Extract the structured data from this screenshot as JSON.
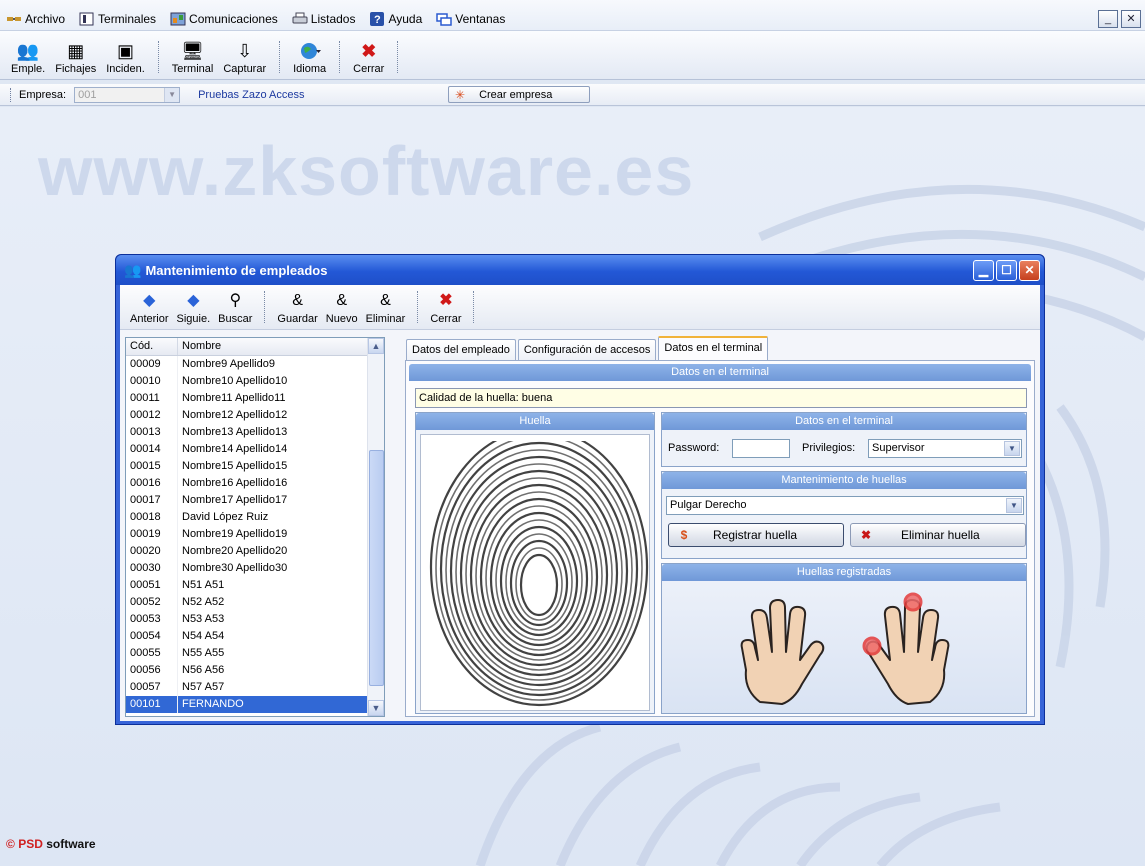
{
  "menu": {
    "items": [
      {
        "label": "Archivo",
        "icon": "plug-icon"
      },
      {
        "label": "Terminales",
        "icon": "terminal-icon"
      },
      {
        "label": "Comunicaciones",
        "icon": "network-icon"
      },
      {
        "label": "Listados",
        "icon": "printer-icon"
      },
      {
        "label": "Ayuda",
        "icon": "help-icon"
      },
      {
        "label": "Ventanas",
        "icon": "windows-icon"
      }
    ]
  },
  "toolbar": {
    "buttons": [
      {
        "label": "Emple.",
        "icon": "employees-icon"
      },
      {
        "label": "Fichajes",
        "icon": "clock-ins-icon"
      },
      {
        "label": "Inciden.",
        "icon": "incidents-icon"
      },
      {
        "label": "Terminal",
        "icon": "terminal-icon"
      },
      {
        "label": "Capturar",
        "icon": "capture-icon"
      },
      {
        "label": "Idioma",
        "icon": "globe-icon"
      },
      {
        "label": "Cerrar",
        "icon": "close-icon"
      }
    ]
  },
  "company": {
    "label": "Empresa:",
    "selected": "001",
    "name": "Pruebas Zazo  Access",
    "create_button": "Crear empresa"
  },
  "desktop": {
    "watermark": "www.zksoftware.es",
    "footer_copy": "©",
    "footer_brand": "PSD",
    "footer_suffix": "software"
  },
  "modal": {
    "title": "Mantenimiento de empleados",
    "toolbar": [
      {
        "label": "Anterior",
        "icon": "arrow-left-icon"
      },
      {
        "label": "Siguie.",
        "icon": "arrow-right-icon"
      },
      {
        "label": "Buscar",
        "icon": "search-icon"
      },
      {
        "label": "Guardar",
        "icon": "save-icon"
      },
      {
        "label": "Nuevo",
        "icon": "add-user-icon"
      },
      {
        "label": "Eliminar",
        "icon": "remove-user-icon"
      },
      {
        "label": "Cerrar",
        "icon": "close-icon"
      }
    ],
    "list": {
      "headers": [
        "Cód.",
        "Nombre"
      ],
      "rows": [
        [
          "00009",
          "Nombre9 Apellido9"
        ],
        [
          "00010",
          "Nombre10 Apellido10"
        ],
        [
          "00011",
          "Nombre11 Apellido11"
        ],
        [
          "00012",
          "Nombre12 Apellido12"
        ],
        [
          "00013",
          "Nombre13 Apellido13"
        ],
        [
          "00014",
          "Nombre14 Apellido14"
        ],
        [
          "00015",
          "Nombre15 Apellido15"
        ],
        [
          "00016",
          "Nombre16 Apellido16"
        ],
        [
          "00017",
          "Nombre17 Apellido17"
        ],
        [
          "00018",
          "David López Ruiz"
        ],
        [
          "00019",
          "Nombre19 Apellido19"
        ],
        [
          "00020",
          "Nombre20 Apellido20"
        ],
        [
          "00030",
          "Nombre30 Apellido30"
        ],
        [
          "00051",
          "N51 A51"
        ],
        [
          "00052",
          "N52 A52"
        ],
        [
          "00053",
          "N53 A53"
        ],
        [
          "00054",
          "N54 A54"
        ],
        [
          "00055",
          "N55 A55"
        ],
        [
          "00056",
          "N56 A56"
        ],
        [
          "00057",
          "N57 A57"
        ],
        [
          "00101",
          "FERNANDO"
        ]
      ],
      "selected_index": 20
    },
    "tabs": [
      "Datos del empleado",
      "Configuración de accesos",
      "Datos en el terminal"
    ],
    "active_tab": 2,
    "panel": {
      "header": "Datos en el terminal",
      "quality": "Calidad de la huella: buena",
      "huella_title": "Huella",
      "terminal_title": "Datos en el terminal",
      "password_label": "Password:",
      "password_value": "",
      "privileges_label": "Privilegios:",
      "privileges_value": "Supervisor",
      "maintenance_title": "Mantenimiento de huellas",
      "finger_value": "Pulgar Derecho",
      "register_button": "Registrar huella",
      "delete_button": "Eliminar huella",
      "registered_title": "Huellas registradas"
    }
  },
  "colors": {
    "title_blue": "#2358d6",
    "selection": "#3168d5",
    "group_header": "#7ea4de",
    "company_name": "#1d3aa0"
  }
}
